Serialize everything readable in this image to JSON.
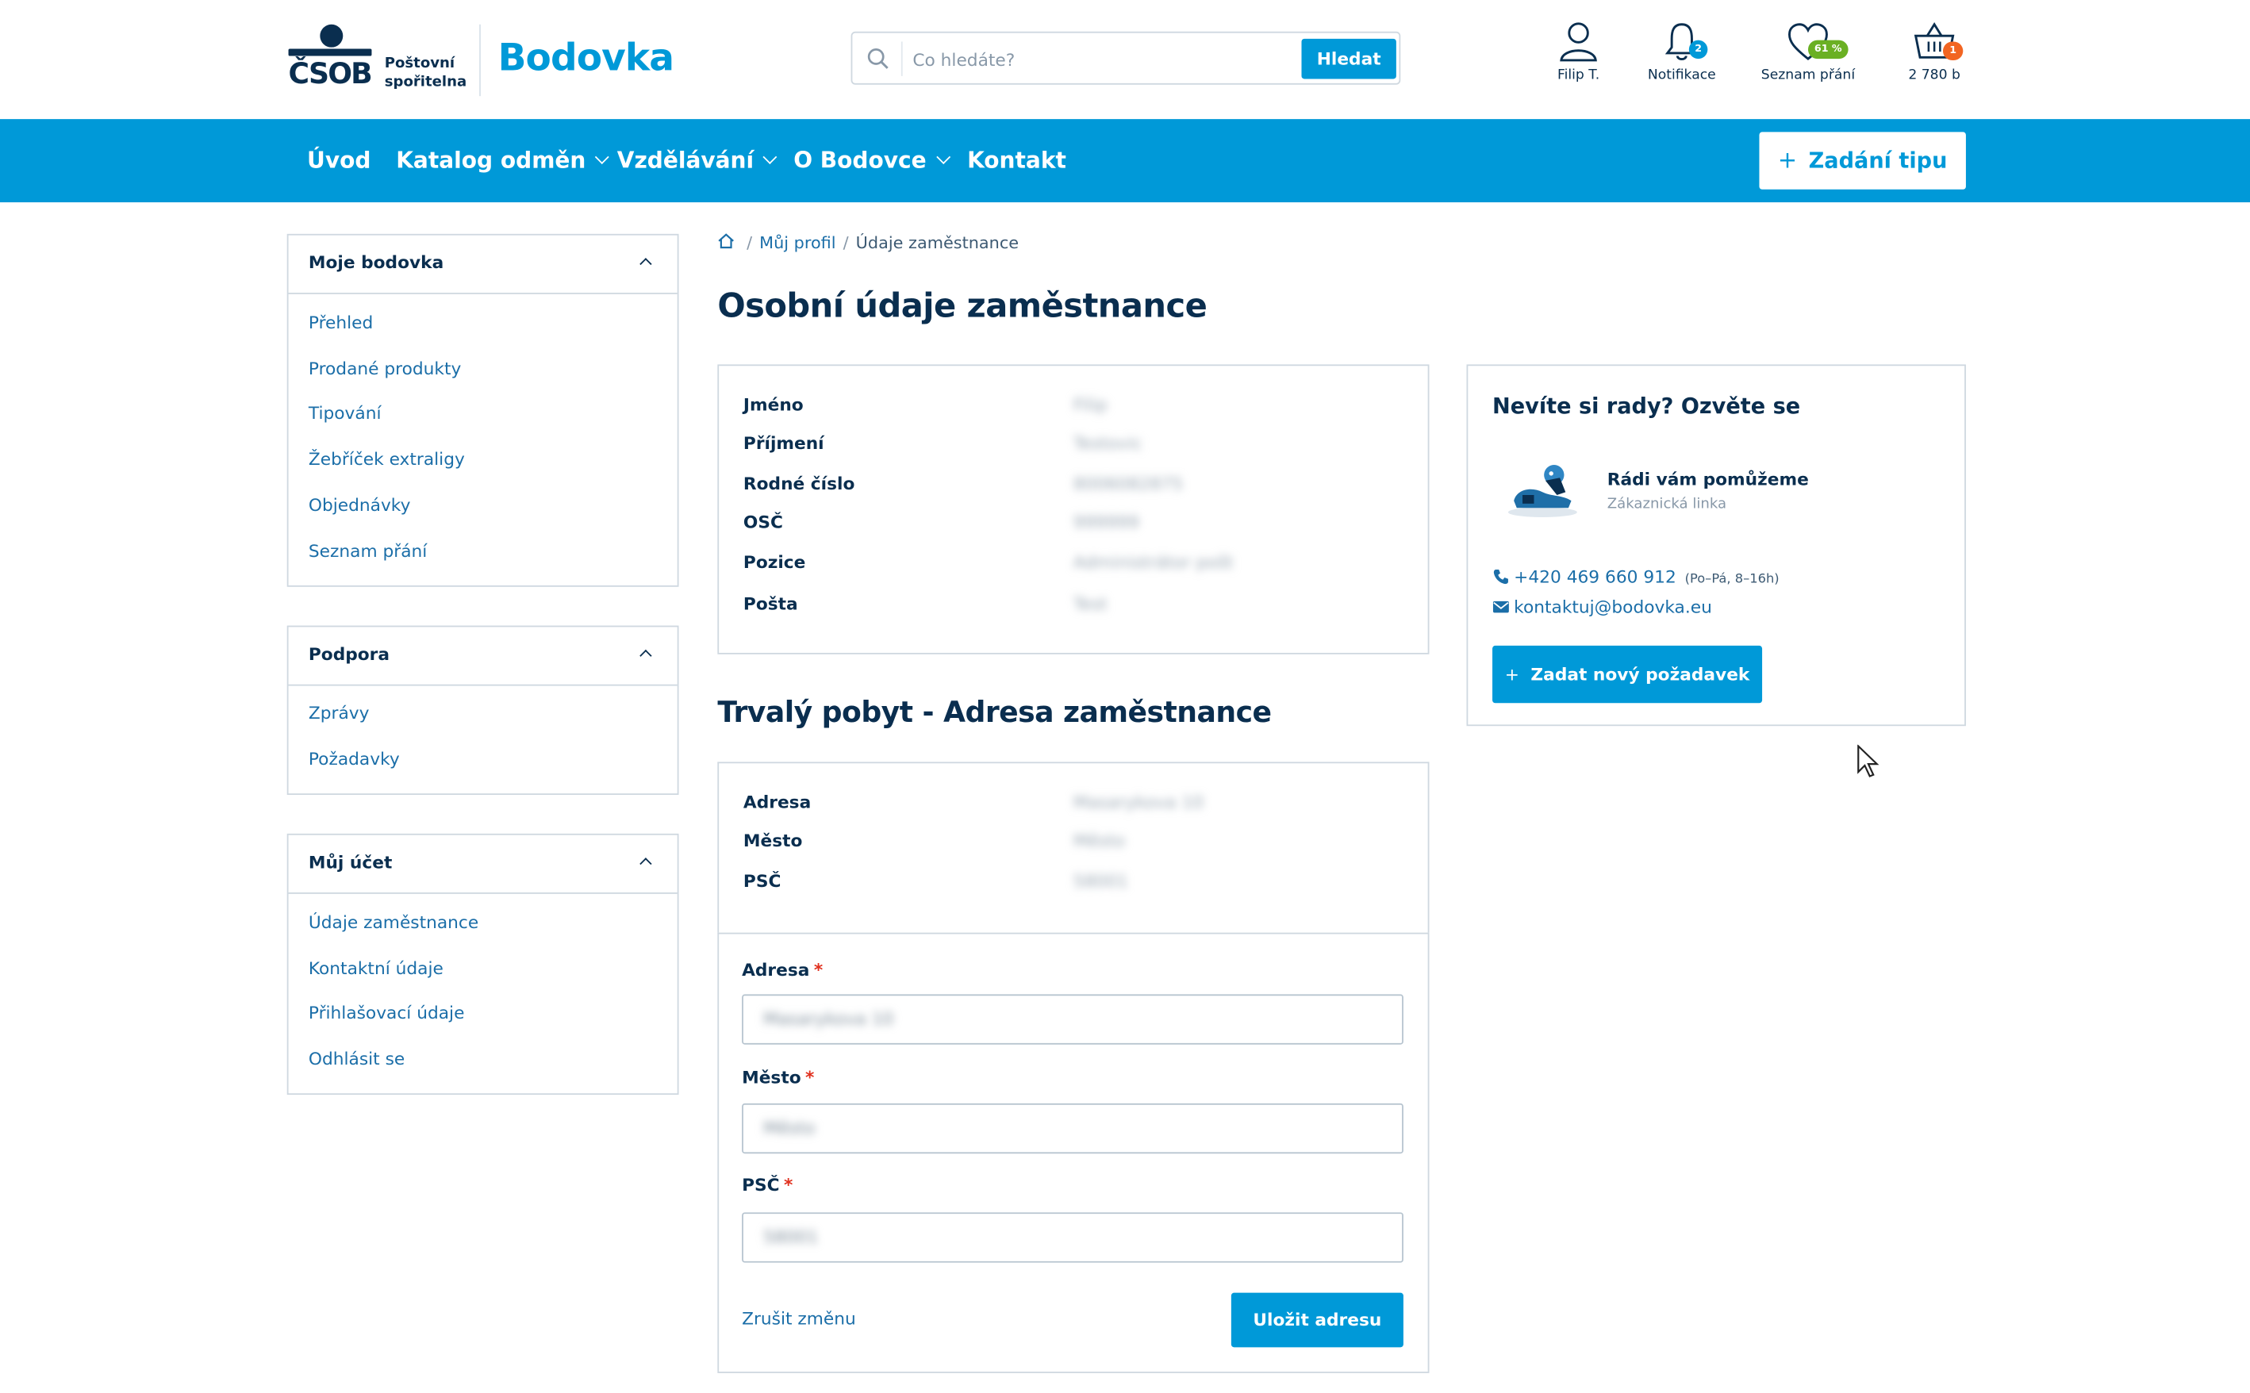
{
  "brand": {
    "logo_text": "ČSOB",
    "logo_sub_1": "Poštovní",
    "logo_sub_2": "spořitelna",
    "app_name": "Bodovka"
  },
  "search": {
    "placeholder": "Co hledáte?",
    "button_label": "Hledat"
  },
  "header_icons": {
    "profile": {
      "label": "Filip T.",
      "icon": "user-icon"
    },
    "notifications": {
      "label": "Notifikace",
      "icon": "bell-icon",
      "badge": "2"
    },
    "wishlist": {
      "label": "Seznam přání",
      "icon": "heart-icon",
      "badge": "61 %"
    },
    "cart": {
      "label": "2 780 b",
      "icon": "basket-icon",
      "badge": "1"
    }
  },
  "nav": {
    "items": [
      "Úvod",
      "Katalog odměn",
      "Vzdělávání",
      "O Bodovce",
      "Kontakt"
    ],
    "cta_label": "Zadání tipu"
  },
  "sidebar": {
    "sections": [
      {
        "title": "Moje bodovka",
        "items": [
          "Přehled",
          "Prodané produkty",
          "Tipování",
          "Žebříček extraligy",
          "Objednávky",
          "Seznam přání"
        ]
      },
      {
        "title": "Podpora",
        "items": [
          "Zprávy",
          "Požadavky"
        ]
      },
      {
        "title": "Můj účet",
        "items": [
          "Údaje zaměstnance",
          "Kontaktní údaje",
          "Přihlašovací údaje",
          "Odhlásit se"
        ]
      }
    ]
  },
  "breadcrumb": [
    "Můj profil",
    "Údaje zaměstnance"
  ],
  "personal": {
    "title": "Osobní údaje zaměstnance",
    "rows": [
      {
        "label": "Jméno",
        "value": "Filip"
      },
      {
        "label": "Příjmení",
        "value": "Testovic"
      },
      {
        "label": "Rodné číslo",
        "value": "8006082875"
      },
      {
        "label": "OSČ",
        "value": "999999"
      },
      {
        "label": "Pozice",
        "value": "Administrátor pošt"
      },
      {
        "label": "Pošta",
        "value": "Test"
      }
    ]
  },
  "address": {
    "title": "Trvalý pobyt - Adresa zaměstnance",
    "rows": [
      {
        "label": "Adresa",
        "value": "Masarykova 10"
      },
      {
        "label": "Město",
        "value": "Město"
      },
      {
        "label": "PSČ",
        "value": "58001"
      }
    ],
    "form": {
      "fields": [
        {
          "label": "Adresa",
          "required": "*",
          "value": "Masarykova 10"
        },
        {
          "label": "Město",
          "required": "*",
          "value": "Město"
        },
        {
          "label": "PSČ",
          "required": "*",
          "value": "58001"
        }
      ],
      "cancel_label": "Zrušit změnu",
      "save_label": "Uložit adresu"
    }
  },
  "help": {
    "title": "Nevíte si rady? Ozvěte se",
    "heading": "Rádi vám pomůžeme",
    "subheading": "Zákaznická linka",
    "phone": "+420 469 660 912",
    "hours": "(Po–Pá, 8–16h)",
    "email": "kontaktuj@bodovka.eu",
    "button_label": "Zadat nový požadavek"
  },
  "colors": {
    "accent": "#0099d8",
    "navy": "#0a2e4f",
    "link": "#1b6ea8",
    "badge_orange": "#f26522",
    "badge_green": "#6ab023",
    "required": "#e0301e"
  }
}
